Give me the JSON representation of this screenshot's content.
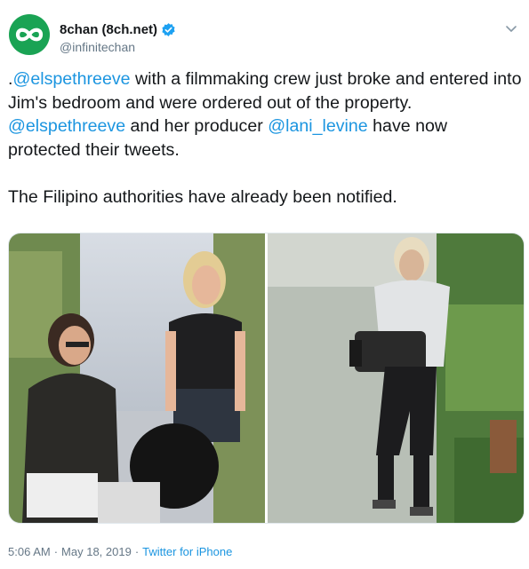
{
  "tweet": {
    "display_name": "8chan (8ch.net)",
    "handle": "@infinitechan",
    "verified": true,
    "text": {
      "line1_prefix": ".",
      "mention1": "@elspethreeve",
      "line1_rest": " with a filmmaking crew just broke and entered into Jim's bedroom and were ordered out of the property.",
      "mention2": "@elspethreeve",
      "mid": " and her producer ",
      "mention3": "@lani_levine",
      "line3_rest": " have now protected their tweets.",
      "paragraph2": "The Filipino authorities have already been notified."
    },
    "time": "5:06 AM",
    "date": "May 18, 2019",
    "source": "Twitter for iPhone",
    "separator": "·"
  },
  "icons": {
    "avatar": "infinity-icon",
    "verified": "verified-badge-icon",
    "menu": "chevron-down-icon"
  },
  "colors": {
    "link": "#1b95e0",
    "avatar_bg": "#1aa354",
    "secondary_text": "#657786",
    "primary_text": "#14171a"
  }
}
